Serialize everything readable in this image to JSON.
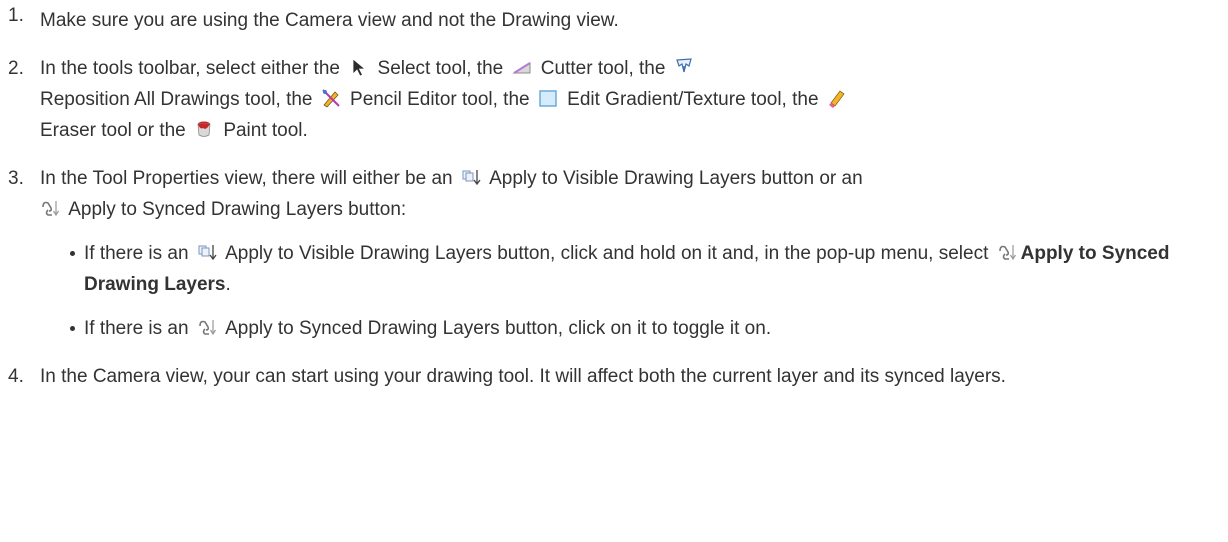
{
  "steps": [
    {
      "number": "1.",
      "text": "Make sure you are using the Camera view and not the Drawing view."
    },
    {
      "number": "2.",
      "parts": {
        "a": "In the tools toolbar, select either the",
        "b": "Select tool, the",
        "c": "Cutter tool, the",
        "d": "Reposition All Drawings tool, the",
        "e": "Pencil Editor tool, the",
        "f": "Edit Gradient/Texture tool, the",
        "g": "Eraser tool or the",
        "h": "Paint tool."
      },
      "icons": [
        "select-tool-icon",
        "cutter-tool-icon",
        "reposition-all-drawings-icon",
        "pencil-editor-icon",
        "edit-gradient-texture-icon",
        "eraser-icon",
        "paint-icon"
      ]
    },
    {
      "number": "3.",
      "parts": {
        "a": "In the Tool Properties view, there will either be an",
        "b": "Apply to Visible Drawing Layers button or an",
        "c": "Apply to Synced Drawing Layers button:"
      },
      "bullets": [
        {
          "a": "If there is an",
          "b": "Apply to Visible Drawing Layers button, click and hold on it and, in the pop-up menu, select",
          "bold": "Apply to Synced Drawing Layers",
          "c": "."
        },
        {
          "a": "If there is an",
          "b": "Apply to Synced Drawing Layers button, click on it to toggle it on."
        }
      ]
    },
    {
      "number": "4.",
      "text": "In the Camera view, your can start using your drawing tool. It will affect both the current layer and its synced layers."
    }
  ]
}
